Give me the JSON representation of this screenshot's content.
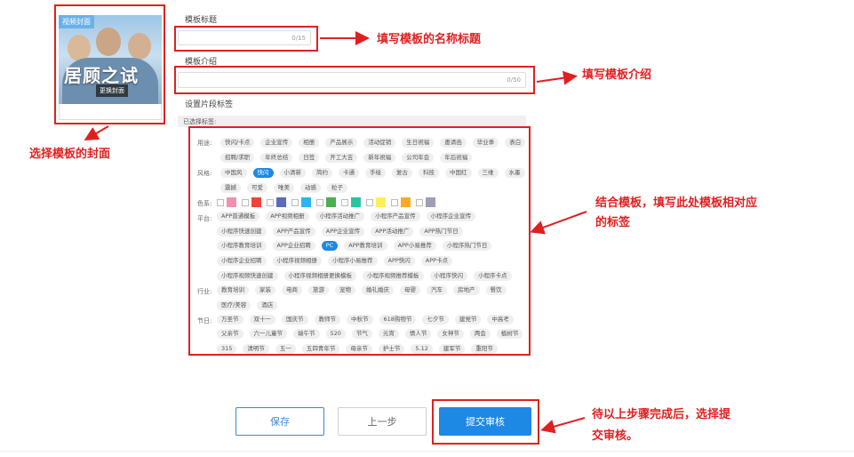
{
  "cover": {
    "tag": "视频封面",
    "title": "居顾之试",
    "change_label": "更换封面"
  },
  "form": {
    "title_label": "模板标题",
    "title_counter": "0/15",
    "intro_label": "模板介绍",
    "intro_counter": "0/50",
    "tags_label": "设置片段标签",
    "selected_label": "已选择标签:"
  },
  "tag_groups": [
    {
      "label": "用途:",
      "rows": [
        [
          "快闪/卡点",
          "企业宣传",
          "相册",
          "产品展示",
          "活动促销",
          "生日祝福",
          "邀请函",
          "毕业季",
          "表白"
        ],
        [
          "招聘/求职",
          "年终总结",
          "日签",
          "开工大吉",
          "新年祝福",
          "公司年会",
          "年后祝福"
        ]
      ]
    },
    {
      "label": "风格:",
      "rows": [
        [
          "中国风",
          "快闪",
          "小清新",
          "简约",
          "卡通",
          "手绘",
          "复古",
          "科技",
          "中国红",
          "三维",
          "水墨"
        ],
        [
          "震撼",
          "可爱",
          "唯美",
          "动感",
          "粒子"
        ]
      ],
      "active": "快闪"
    },
    {
      "label": "平台:",
      "rows": [
        [
          "APP普通模板",
          "APP视频相册",
          "小程序活动推广",
          "小程序产品宣传",
          "小程序企业宣传"
        ],
        [
          "小程序快速创建",
          "APP产品宣传",
          "APP企业宣传",
          "APP活动推广",
          "APP热门节日"
        ],
        [
          "小程序教育培训",
          "APP企业招聘",
          "PC",
          "APP教育培训",
          "APP小易推荐",
          "小程序热门节日"
        ],
        [
          "小程序企业招聘",
          "小程序视频相册",
          "小程序小易推荐",
          "APP快闪",
          "APP卡点"
        ],
        [
          "小程序视频快速创建",
          "小程序视频相册更换模板",
          "小程序视频推荐模板",
          "小程序快闪",
          "小程序卡点"
        ]
      ],
      "active": "PC"
    },
    {
      "label": "行业:",
      "rows": [
        [
          "教育培训",
          "家装",
          "电商",
          "旅游",
          "宠物",
          "婚礼婚庆",
          "母婴",
          "汽车",
          "房地产",
          "餐饮"
        ],
        [
          "医疗/美容",
          "酒店"
        ]
      ]
    },
    {
      "label": "节日:",
      "rows": [
        [
          "万圣节",
          "双十一",
          "国庆节",
          "教师节",
          "中秋节",
          "618购物节",
          "七夕节",
          "建党节",
          "中高考"
        ],
        [
          "父亲节",
          "六一儿童节",
          "端午节",
          "520",
          "节气",
          "元宵",
          "情人节",
          "女神节",
          "两会",
          "植树节"
        ],
        [
          "315",
          "清明节",
          "五一",
          "五四青年节",
          "母亲节",
          "护士节",
          "5.12",
          "建军节",
          "重阳节"
        ]
      ]
    }
  ],
  "colors": {
    "label": "色系:",
    "swatches": [
      "#f48fb1",
      "#f44336",
      "#5c6bc0",
      "#29b6f6",
      "#4caf50",
      "#26c6a4",
      "#ffee58",
      "#ffa726",
      "#9e9eb8"
    ]
  },
  "buttons": {
    "save": "保存",
    "prev": "上一步",
    "submit": "提交审核"
  },
  "annotations": {
    "title": "填写模板的名称标题",
    "intro": "填写模板介绍",
    "cover": "选择模板的封面",
    "tags_line1": "结合模板，填写此处模板相对应",
    "tags_line2": "的标签",
    "submit_line1": "待以上步骤完成后，选择提",
    "submit_line2": "交审核。"
  },
  "theme": {
    "accent": "#1e88e5",
    "annotation": "#e02020"
  }
}
